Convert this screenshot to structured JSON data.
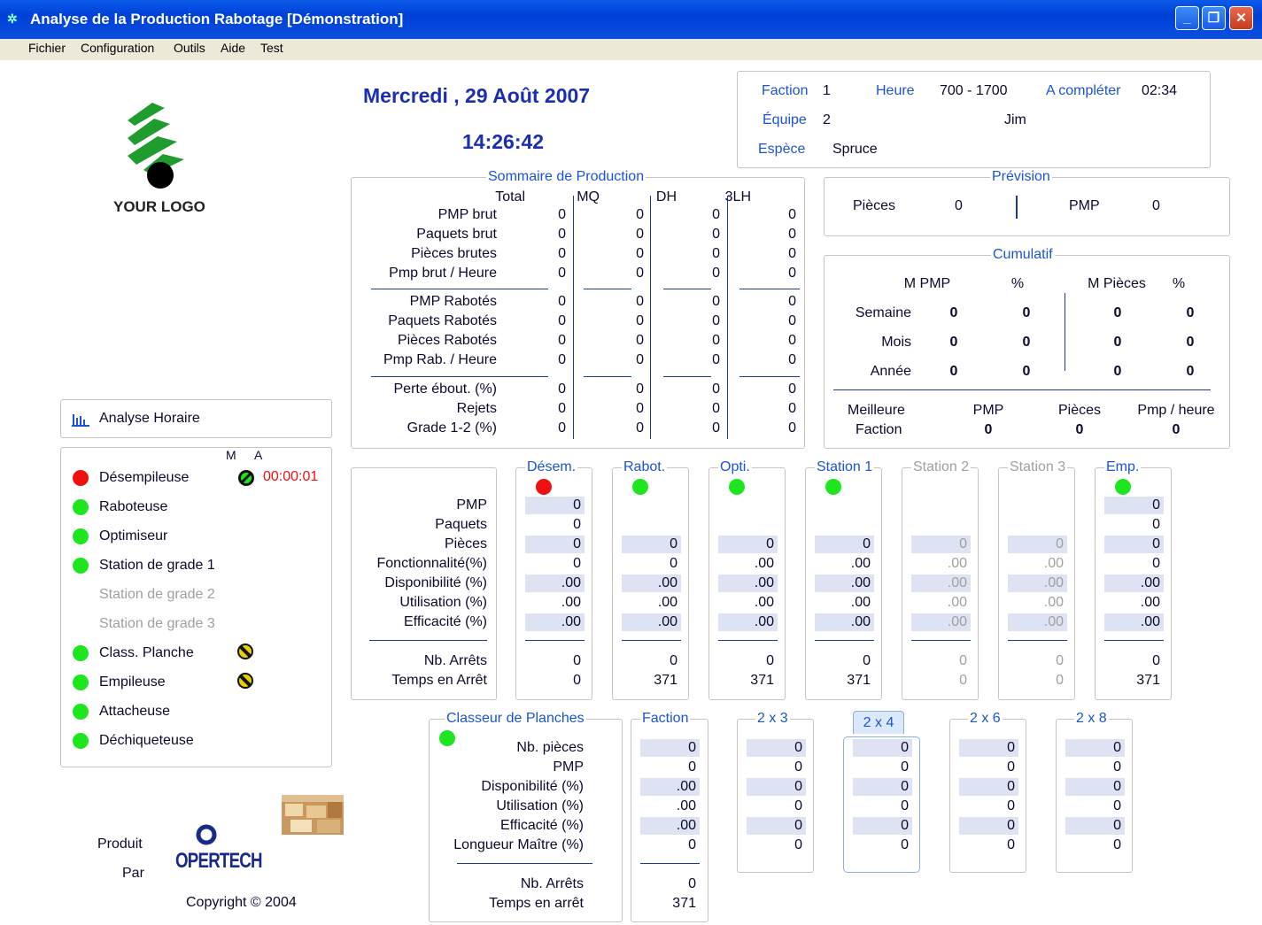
{
  "window": {
    "title": "Analyse de la Production Rabotage [Démonstration]"
  },
  "menu": [
    "Fichier",
    "Configuration",
    "Outils",
    "Aide",
    "Test"
  ],
  "logo": {
    "text": "YOUR LOGO"
  },
  "header": {
    "date": "Mercredi , 29  Août  2007",
    "time": "14:26:42"
  },
  "info": {
    "faction_label": "Faction",
    "faction": "1",
    "heure_label": "Heure",
    "heure": "700 - 1700",
    "completer_label": "A compléter",
    "completer": "02:34",
    "equipe_label": "Équipe",
    "equipe": "2",
    "operator": "Jim",
    "espece_label": "Espèce",
    "espece": "Spruce"
  },
  "sommaire": {
    "title": "Sommaire de Production",
    "cols": [
      "Total",
      "MQ",
      "DH",
      "3LH"
    ],
    "rows": [
      {
        "label": "PMP brut",
        "values": [
          "0",
          "0",
          "0",
          "0"
        ]
      },
      {
        "label": "Paquets brut",
        "values": [
          "0",
          "0",
          "0",
          "0"
        ]
      },
      {
        "label": "Pièces brutes",
        "values": [
          "0",
          "0",
          "0",
          "0"
        ]
      },
      {
        "label": "Pmp brut / Heure",
        "values": [
          "0",
          "0",
          "0",
          "0"
        ]
      },
      {
        "label": "PMP Rabotés",
        "values": [
          "0",
          "0",
          "0",
          "0"
        ]
      },
      {
        "label": "Paquets Rabotés",
        "values": [
          "0",
          "0",
          "0",
          "0"
        ]
      },
      {
        "label": "Pièces Rabotés",
        "values": [
          "0",
          "0",
          "0",
          "0"
        ]
      },
      {
        "label": "Pmp Rab. / Heure",
        "values": [
          "0",
          "0",
          "0",
          "0"
        ]
      },
      {
        "label": "Perte ébout. (%)",
        "values": [
          "0",
          "0",
          "0",
          "0"
        ]
      },
      {
        "label": "Rejets",
        "values": [
          "0",
          "0",
          "0",
          "0"
        ]
      },
      {
        "label": "Grade 1-2 (%)",
        "values": [
          "0",
          "0",
          "0",
          "0"
        ]
      }
    ]
  },
  "prevision": {
    "title": "Prévision",
    "pieces_label": "Pièces",
    "pieces": "0",
    "pmp_label": "PMP",
    "pmp": "0"
  },
  "cumulatif": {
    "title": "Cumulatif",
    "cols": [
      "M PMP",
      "%",
      "M Pièces",
      "%"
    ],
    "rows": [
      {
        "label": "Semaine",
        "values": [
          "0",
          "0",
          "0",
          "0"
        ]
      },
      {
        "label": "Mois",
        "values": [
          "0",
          "0",
          "0",
          "0"
        ]
      },
      {
        "label": "Année",
        "values": [
          "0",
          "0",
          "0",
          "0"
        ]
      }
    ],
    "best_label_1": "Meilleure",
    "best_label_2": "Faction",
    "best_cols": [
      "PMP",
      "Pièces",
      "Pmp / heure"
    ],
    "best_values": [
      "0",
      "0",
      "0"
    ]
  },
  "analyse_button": "Analyse Horaire",
  "status_panel": {
    "m_label": "M",
    "a_label": "A",
    "timer": "00:00:01",
    "items": [
      {
        "label": "Désempileuse",
        "state": "red",
        "enabled": true
      },
      {
        "label": "Raboteuse",
        "state": "green",
        "enabled": true
      },
      {
        "label": "Optimiseur",
        "state": "green",
        "enabled": true
      },
      {
        "label": "Station de grade 1",
        "state": "green",
        "enabled": true
      },
      {
        "label": "Station de grade 2",
        "state": "none",
        "enabled": false
      },
      {
        "label": "Station de grade 3",
        "state": "none",
        "enabled": false
      },
      {
        "label": "Class. Planche",
        "state": "green",
        "enabled": true
      },
      {
        "label": "Empileuse",
        "state": "green",
        "enabled": true
      },
      {
        "label": "Attacheuse",
        "state": "green",
        "enabled": true
      },
      {
        "label": "Déchiqueteuse",
        "state": "green",
        "enabled": true
      }
    ]
  },
  "machines": {
    "row_labels": [
      "PMP",
      "Paquets",
      "Pièces",
      "Fonctionnalité(%)",
      "Disponibilité (%)",
      "Utilisation (%)",
      "Efficacité (%)",
      "Nb. Arrêts",
      "Temps en Arrêt"
    ],
    "cols": [
      {
        "title": "Désem.",
        "state": "red",
        "enabled": true,
        "values": [
          "0",
          "0",
          "0",
          "0",
          ".00",
          ".00",
          ".00",
          "0",
          "0"
        ]
      },
      {
        "title": "Rabot.",
        "state": "green",
        "enabled": true,
        "values": [
          "",
          "",
          "0",
          "0",
          ".00",
          ".00",
          ".00",
          "0",
          "371"
        ]
      },
      {
        "title": "Opti.",
        "state": "green",
        "enabled": true,
        "values": [
          "",
          "",
          "0",
          ".00",
          ".00",
          ".00",
          ".00",
          "0",
          "371"
        ]
      },
      {
        "title": "Station 1",
        "state": "green",
        "enabled": true,
        "values": [
          "",
          "",
          "0",
          ".00",
          ".00",
          ".00",
          ".00",
          "0",
          "371"
        ]
      },
      {
        "title": "Station 2",
        "state": "none",
        "enabled": false,
        "values": [
          "",
          "",
          "0",
          ".00",
          ".00",
          ".00",
          ".00",
          "0",
          "0"
        ]
      },
      {
        "title": "Station 3",
        "state": "none",
        "enabled": false,
        "values": [
          "",
          "",
          "0",
          ".00",
          ".00",
          ".00",
          ".00",
          "0",
          "0"
        ]
      },
      {
        "title": "Emp.",
        "state": "green",
        "enabled": true,
        "values": [
          "0",
          "0",
          "0",
          "0",
          ".00",
          ".00",
          ".00",
          "0",
          "371"
        ]
      }
    ]
  },
  "classeur": {
    "title": "Classeur de Planches",
    "row_labels": [
      "Nb. pièces",
      "PMP",
      "Disponibilité (%)",
      "Utilisation (%)",
      "Efficacité (%)",
      "Longueur Maître (%)",
      "Nb. Arrêts",
      "Temps en arrêt"
    ],
    "faction_title": "Faction",
    "faction_values": [
      "0",
      "0",
      ".00",
      ".00",
      ".00",
      "0",
      "0",
      "371"
    ],
    "sizes": [
      {
        "title": "2 x 3",
        "values": [
          "0",
          "0",
          "0",
          "0",
          "0",
          "0"
        ]
      },
      {
        "title": "2 x 4",
        "values": [
          "0",
          "0",
          "0",
          "0",
          "0",
          "0"
        ]
      },
      {
        "title": "2 x 6",
        "values": [
          "0",
          "0",
          "0",
          "0",
          "0",
          "0"
        ]
      },
      {
        "title": "2 x 8",
        "values": [
          "0",
          "0",
          "0",
          "0",
          "0",
          "0"
        ]
      }
    ]
  },
  "footer": {
    "produit": "Produit",
    "par": "Par",
    "brand": "OPERTECH",
    "copyright": "Copyright ©  2004"
  }
}
